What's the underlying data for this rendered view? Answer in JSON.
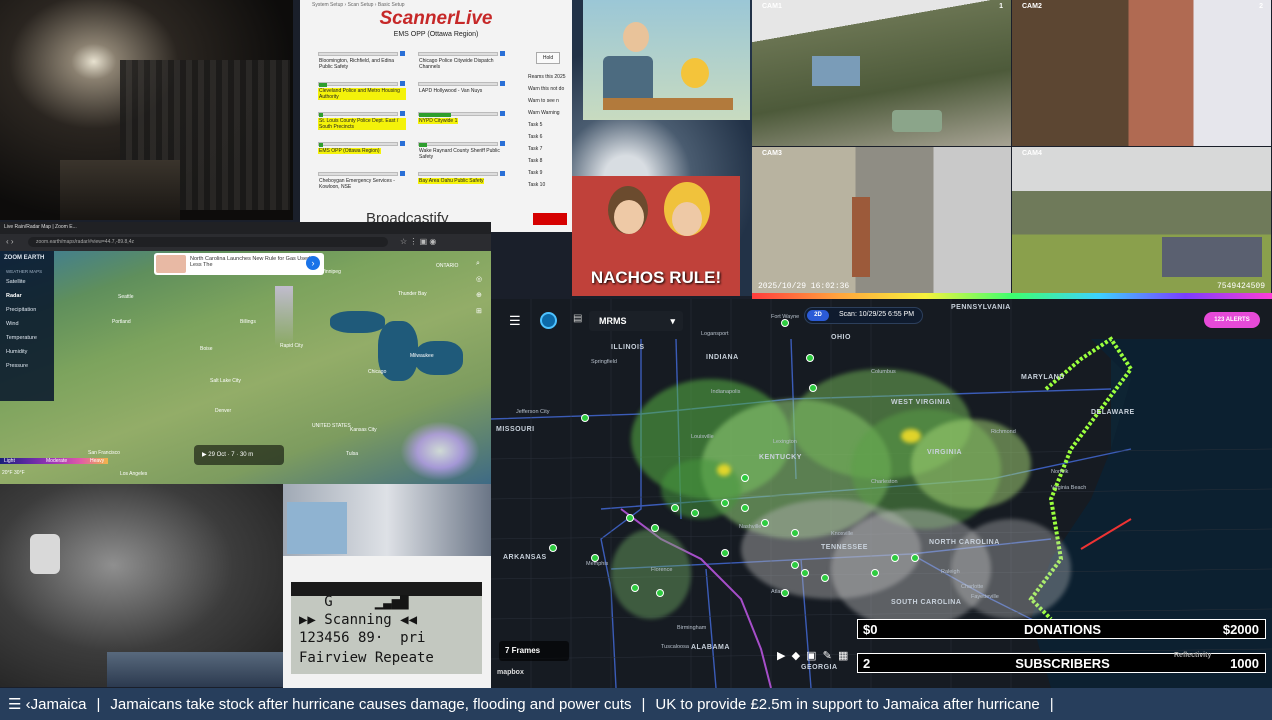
{
  "hallway_cam": {},
  "scanner_live": {
    "menu": "System Setup  ›  Scan Setup  ›  Basic Setup",
    "brand": "ScannerLive",
    "subtitle": "EMS OPP (Ottawa Region)",
    "hold_label": "Hold",
    "channels_left": [
      {
        "label": "Bloomington, Richfield, and Edina Public Safety",
        "highlight": false,
        "level": 0
      },
      {
        "label": "Cleveland Police and Metro Housing Authority",
        "highlight": true,
        "level": 0.1
      },
      {
        "label": "St. Louis County Police Dept. East / South Precincts",
        "highlight": true,
        "level": 0.05
      },
      {
        "label": "EMS OPP (Ottawa Region)",
        "highlight": true,
        "level": 0.05
      },
      {
        "label": "Cheboygan Emergency Services - Kowloon, NSE",
        "highlight": false,
        "level": 0
      }
    ],
    "channels_right": [
      {
        "label": "Chicago Police Citywide Dispatch Channels",
        "highlight": false,
        "level": 0
      },
      {
        "label": "LAPD Hollywood - Van Nuys",
        "highlight": false,
        "level": 0
      },
      {
        "label": "NYPD Citywide 1",
        "highlight": true,
        "level": 0.4
      },
      {
        "label": "Wake Raynard County Sheriff Public Safety",
        "highlight": false,
        "level": 0.1
      },
      {
        "label": "Bay Area Oahu Public Safety",
        "highlight": true,
        "level": 0
      }
    ],
    "radio_options": [
      "Reams this 2025",
      "Warn this not do",
      "Warn to see n",
      "Warn Warning",
      "Task 5",
      "Task 6",
      "Task 7",
      "Task 8",
      "Task 9",
      "Task 10"
    ],
    "broadcastify": "Broadcastify"
  },
  "cartoon": {
    "caption": "NACHOS RULE!"
  },
  "cameras": [
    {
      "tag": "CAM1",
      "num": "1"
    },
    {
      "tag": "CAM2",
      "num": "2"
    },
    {
      "tag": "CAM3",
      "stamp": "2025/10/29  16:02:36"
    },
    {
      "tag": "CAM4",
      "code": "7549424509"
    }
  ],
  "zoom_earth": {
    "tab_title": "Live Rain/Radar Map | Zoom E...",
    "url": "zoom.earth/maps/radar/#view=44.7,-89.8,4z",
    "logo": "ZOOM EARTH",
    "menu_header": "WEATHER MAPS",
    "menu": [
      "Satellite",
      "Radar",
      "Precipitation",
      "Wind",
      "Temperature",
      "Humidity",
      "Pressure"
    ],
    "active_menu": "Radar",
    "ad_text": "North Carolina Launches New Rule for Gas Used Less The",
    "timebar": "29 Oct  ·  7  ·  30 m",
    "cities": [
      {
        "name": "Calgary"
      },
      {
        "name": "Winnipeg"
      },
      {
        "name": "ONTARIO"
      },
      {
        "name": "Seattle"
      },
      {
        "name": "Portland"
      },
      {
        "name": "Boise"
      },
      {
        "name": "Billings"
      },
      {
        "name": "Rapid City"
      },
      {
        "name": "Milwaukee"
      },
      {
        "name": "Chicago"
      },
      {
        "name": "Salt Lake City"
      },
      {
        "name": "Denver"
      },
      {
        "name": "UNITED STATES"
      },
      {
        "name": "Kansas City"
      },
      {
        "name": "San Francisco"
      },
      {
        "name": "Tulsa"
      },
      {
        "name": "Los Angeles"
      },
      {
        "name": "Thunder Bay"
      },
      {
        "name": "Saskatoon"
      }
    ],
    "legend": [
      "Light",
      "Moderate",
      "Heavy"
    ],
    "temp": "20°F  30°F"
  },
  "pager": {
    "lines": [
      "   G     ▁▃▅▇",
      "▶▶ Scanning ◀◀",
      "123456 89·  pri",
      "Fairview Repeate"
    ]
  },
  "radar": {
    "product": "MRMS",
    "mode": "2D",
    "scan_label": "Scan:",
    "scan_time": "10/29/25 6:55 PM",
    "alerts": "123 ALERTS",
    "frames": "7 Frames",
    "mapbox": "mapbox",
    "reflectivity": "Reflectivity",
    "states": [
      {
        "name": "ILLINOIS"
      },
      {
        "name": "INDIANA"
      },
      {
        "name": "OHIO"
      },
      {
        "name": "PENNSYLVANIA"
      },
      {
        "name": "MISSOURI"
      },
      {
        "name": "KENTUCKY"
      },
      {
        "name": "VIRGINIA"
      },
      {
        "name": "MARYLAND"
      },
      {
        "name": "WEST VIRGINIA"
      },
      {
        "name": "TENNESSEE"
      },
      {
        "name": "NORTH CAROLINA"
      },
      {
        "name": "SOUTH CAROLINA"
      },
      {
        "name": "ARKANSAS"
      },
      {
        "name": "ALABAMA"
      },
      {
        "name": "GEORGIA"
      },
      {
        "name": "DELAWARE"
      }
    ],
    "cities": [
      {
        "name": "Fort Wayne"
      },
      {
        "name": "Logansport"
      },
      {
        "name": "Springfield"
      },
      {
        "name": "Indianapolis"
      },
      {
        "name": "Columbus"
      },
      {
        "name": "Jefferson City"
      },
      {
        "name": "Louisville"
      },
      {
        "name": "Lexington"
      },
      {
        "name": "Charleston"
      },
      {
        "name": "Richmond"
      },
      {
        "name": "Norfolk"
      },
      {
        "name": "Raleigh"
      },
      {
        "name": "Nashville"
      },
      {
        "name": "Knoxville"
      },
      {
        "name": "Memphis"
      },
      {
        "name": "Charlotte"
      },
      {
        "name": "Atlanta"
      },
      {
        "name": "Birmingham"
      },
      {
        "name": "Tuscaloosa"
      },
      {
        "name": "Florence"
      },
      {
        "name": "Fayetteville"
      },
      {
        "name": "Wilmington"
      },
      {
        "name": "Columbia"
      },
      {
        "name": "Virginia Beach"
      }
    ]
  },
  "counters": {
    "donations": {
      "current": "$0",
      "label": "DONATIONS",
      "goal": "$2000"
    },
    "subscribers": {
      "current": "2",
      "label": "SUBSCRIBERS",
      "goal": "1000"
    }
  },
  "ticker": {
    "items": [
      "☰ ‹Jamaica",
      "Jamaicans take stock after hurricane causes damage, flooding and power cuts",
      "UK to provide £2.5m in support to Jamaica after hurricane",
      ""
    ]
  },
  "colors": {
    "ticker_bg": "#273e5c",
    "alerts": "#e64ad8",
    "accent_red": "#d50000"
  }
}
